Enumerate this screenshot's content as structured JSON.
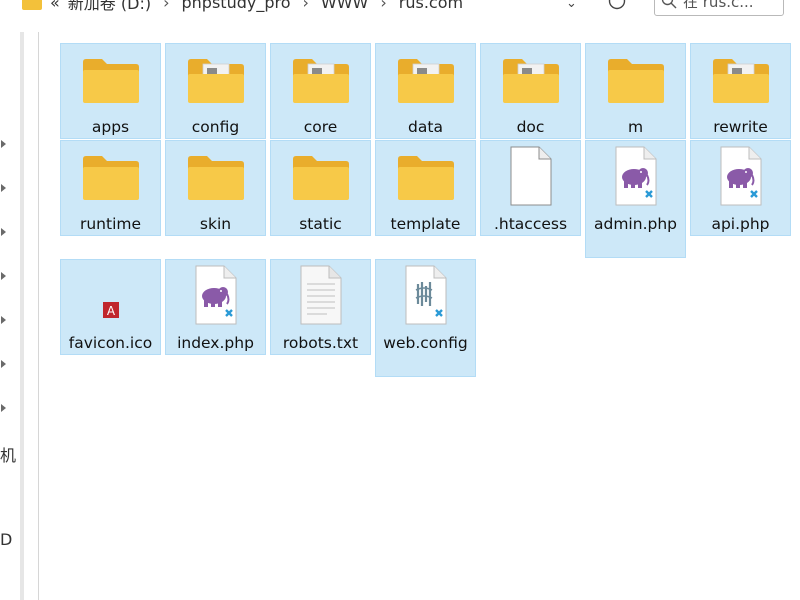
{
  "addressbar": {
    "crumbs": [
      "«",
      "新加卷 (D:)",
      "phpstudy_pro",
      "WWW",
      "rus.com"
    ],
    "search_placeholder": "在 rus.c..."
  },
  "leftnav": {
    "text_a": "机",
    "text_b": "D"
  },
  "items": [
    {
      "name": "apps",
      "icon": "folder-icon"
    },
    {
      "name": "config",
      "icon": "folder-with-files-icon"
    },
    {
      "name": "core",
      "icon": "folder-with-files-icon"
    },
    {
      "name": "data",
      "icon": "folder-with-files-icon"
    },
    {
      "name": "doc",
      "icon": "folder-with-files-icon"
    },
    {
      "name": "m",
      "icon": "folder-icon"
    },
    {
      "name": "rewrite",
      "icon": "folder-with-files-icon"
    },
    {
      "name": "runtime",
      "icon": "folder-icon"
    },
    {
      "name": "skin",
      "icon": "folder-icon"
    },
    {
      "name": "static",
      "icon": "folder-icon"
    },
    {
      "name": "template",
      "icon": "folder-icon"
    },
    {
      "name": ".htaccess",
      "icon": "blank-file-icon"
    },
    {
      "name": "admin.php",
      "icon": "php-file-icon"
    },
    {
      "name": "api.php",
      "icon": "php-file-icon"
    },
    {
      "name": "favicon.ico",
      "icon": "ico-file-icon"
    },
    {
      "name": "index.php",
      "icon": "php-file-icon"
    },
    {
      "name": "robots.txt",
      "icon": "text-file-icon"
    },
    {
      "name": "web.config",
      "icon": "config-file-icon"
    }
  ],
  "colors": {
    "selection_bg": "#cde8f8",
    "selection_border": "#b3dcf6",
    "folder": "#f6c342",
    "php_elephant": "#8a5aa8",
    "vscode_badge": "#2a9ad6"
  }
}
